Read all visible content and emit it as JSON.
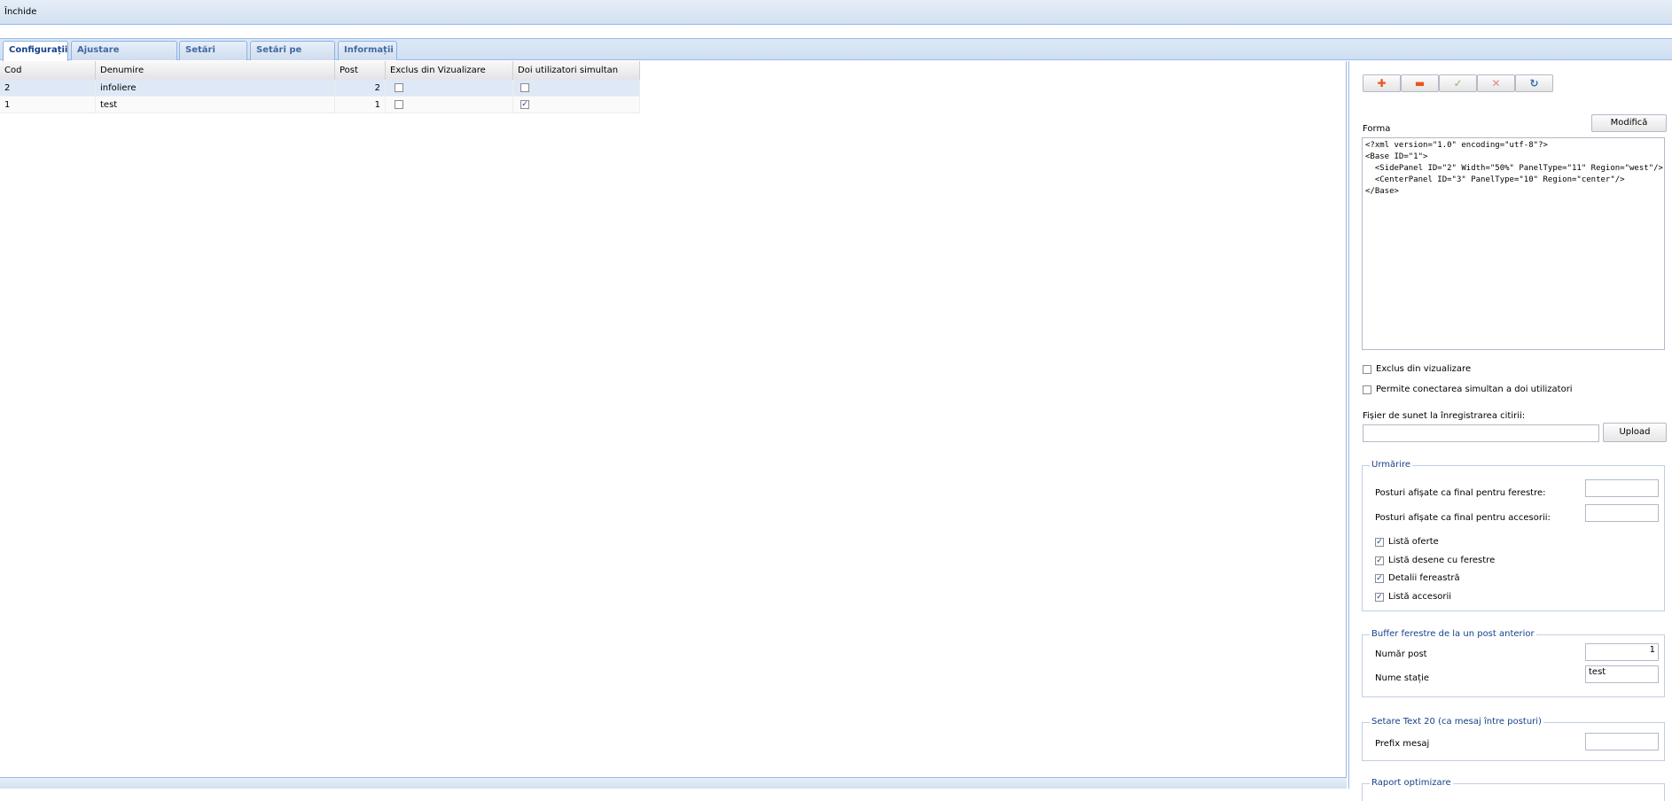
{
  "topbar": {
    "close_label": "Închide"
  },
  "tabs": [
    {
      "label": "Configurații"
    },
    {
      "label": "Ajustare documente"
    },
    {
      "label": "Setări locale"
    },
    {
      "label": "Setări pe server"
    },
    {
      "label": "Informații"
    }
  ],
  "grid": {
    "columns": [
      "Cod",
      "Denumire",
      "Post",
      "Exclus din Vizualizare",
      "Doi utilizatori simultan"
    ],
    "rows": [
      {
        "cod": "2",
        "denumire": "infoliere",
        "post": "2",
        "exclus": false,
        "doi": false
      },
      {
        "cod": "1",
        "denumire": "test",
        "post": "1",
        "exclus": false,
        "doi": true
      }
    ]
  },
  "panel": {
    "toolbar": {
      "add_icon": "plus-icon",
      "remove_icon": "minus-icon",
      "confirm_icon": "check-icon",
      "cancel_icon": "x-icon",
      "refresh_icon": "refresh-icon"
    },
    "modify_label": "Modifică",
    "forma_label": "Forma",
    "forma_text": "<?xml version=\"1.0\" encoding=\"utf-8\"?>\n<Base ID=\"1\">\n  <SidePanel ID=\"2\" Width=\"50%\" PanelType=\"11\" Region=\"west\"/>\n  <CenterPanel ID=\"3\" PanelType=\"10\" Region=\"center\"/>\n</Base>",
    "exclus_label": "Exclus din vizualizare",
    "permite_label": "Permite conectarea simultan a doi utilizatori",
    "sound_label": "Fișier de sunet la înregistrarea citirii:",
    "upload_label": "Upload",
    "urmarire": {
      "legend": "Urmărire",
      "posturi_ferestre": "Posturi afișate ca final pentru ferestre:",
      "posturi_accesorii": "Posturi afișate ca final pentru accesorii:",
      "checks": [
        "Listă oferte",
        "Listă desene cu ferestre",
        "Detalii fereastră",
        "Listă accesorii"
      ]
    },
    "buffer": {
      "legend": "Buffer ferestre de la un post anterior",
      "numar_label": "Număr post",
      "numar_value": "1",
      "nume_label": "Nume stație",
      "nume_value": "test"
    },
    "setare": {
      "legend": "Setare Text 20 (ca mesaj între posturi)",
      "prefix_label": "Prefix mesaj"
    },
    "raport_legend": "Raport optimizare"
  },
  "colors": {
    "accent": "#15428b",
    "border": "#99bbe8"
  }
}
